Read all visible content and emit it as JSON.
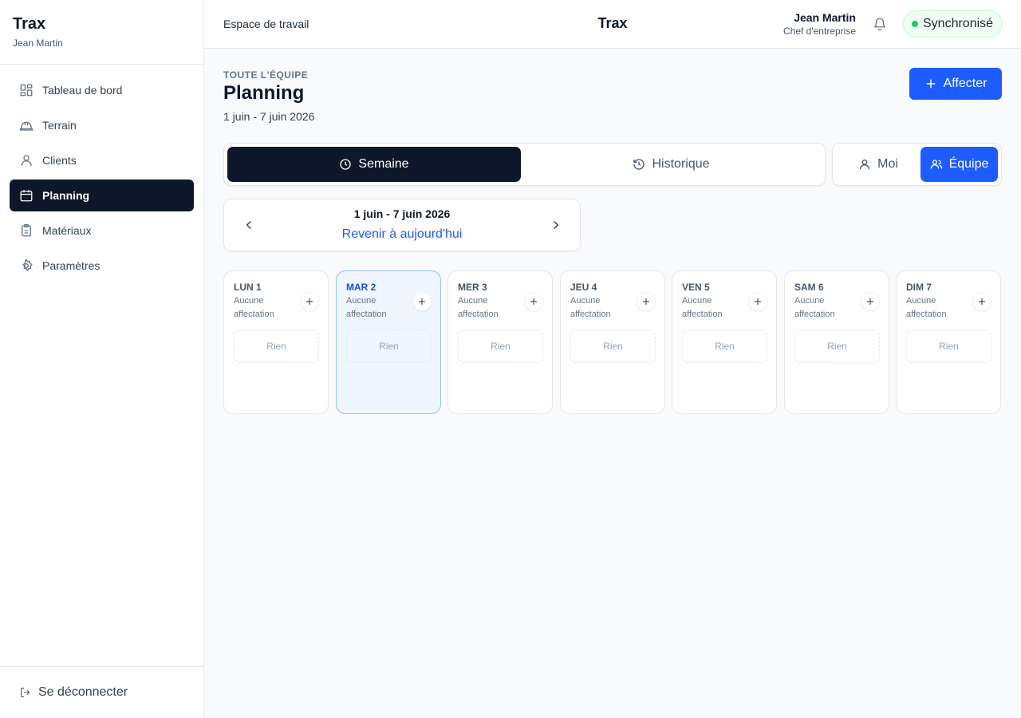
{
  "sidebar": {
    "brand": "Trax",
    "user": "Jean Martin",
    "items": [
      {
        "label": "Tableau de bord",
        "icon": "dashboard-icon"
      },
      {
        "label": "Terrain",
        "icon": "hard-hat-icon"
      },
      {
        "label": "Clients",
        "icon": "user-icon"
      },
      {
        "label": "Planning",
        "icon": "calendar-icon",
        "active": true
      },
      {
        "label": "Matériaux",
        "icon": "clipboard-icon"
      },
      {
        "label": "Paramètres",
        "icon": "gear-icon"
      }
    ],
    "logout": "Se déconnecter"
  },
  "topbar": {
    "workspace": "Espace de travail",
    "title": "Trax",
    "user_name": "Jean Martin",
    "user_role": "Chef d'entreprise",
    "sync_status": "Synchronisé",
    "sync_color": "#22c55e"
  },
  "main": {
    "eyebrow": "TOUTE L'ÉQUIPE",
    "title": "Planning",
    "range": "1 juin - 7 juin 2026",
    "assign_label": "Affecter",
    "view_tabs": [
      {
        "label": "Semaine",
        "active": true
      },
      {
        "label": "Historique",
        "active": false
      }
    ],
    "scope_tabs": [
      {
        "label": "Moi",
        "active": false
      },
      {
        "label": "Équipe",
        "active": true
      }
    ],
    "week_nav": {
      "range": "1 juin - 7 juin 2026",
      "today_link": "Revenir à aujourd'hui"
    },
    "days": [
      {
        "label": "LUN 1",
        "status": "Aucune affectation",
        "empty": "Rien",
        "today": false
      },
      {
        "label": "MAR 2",
        "status": "Aucune affectation",
        "empty": "Rien",
        "today": true
      },
      {
        "label": "MER 3",
        "status": "Aucune affectation",
        "empty": "Rien",
        "today": false
      },
      {
        "label": "JEU 4",
        "status": "Aucune affectation",
        "empty": "Rien",
        "today": false
      },
      {
        "label": "VEN 5",
        "status": "Aucune affectation",
        "empty": "Rien",
        "today": false
      },
      {
        "label": "SAM 6",
        "status": "Aucune affectation",
        "empty": "Rien",
        "today": false
      },
      {
        "label": "DIM 7",
        "status": "Aucune affectation",
        "empty": "Rien",
        "today": false
      }
    ]
  },
  "colors": {
    "accent": "#1d5cff",
    "dark": "#0f172a",
    "today_bg": "#eff6ff"
  }
}
